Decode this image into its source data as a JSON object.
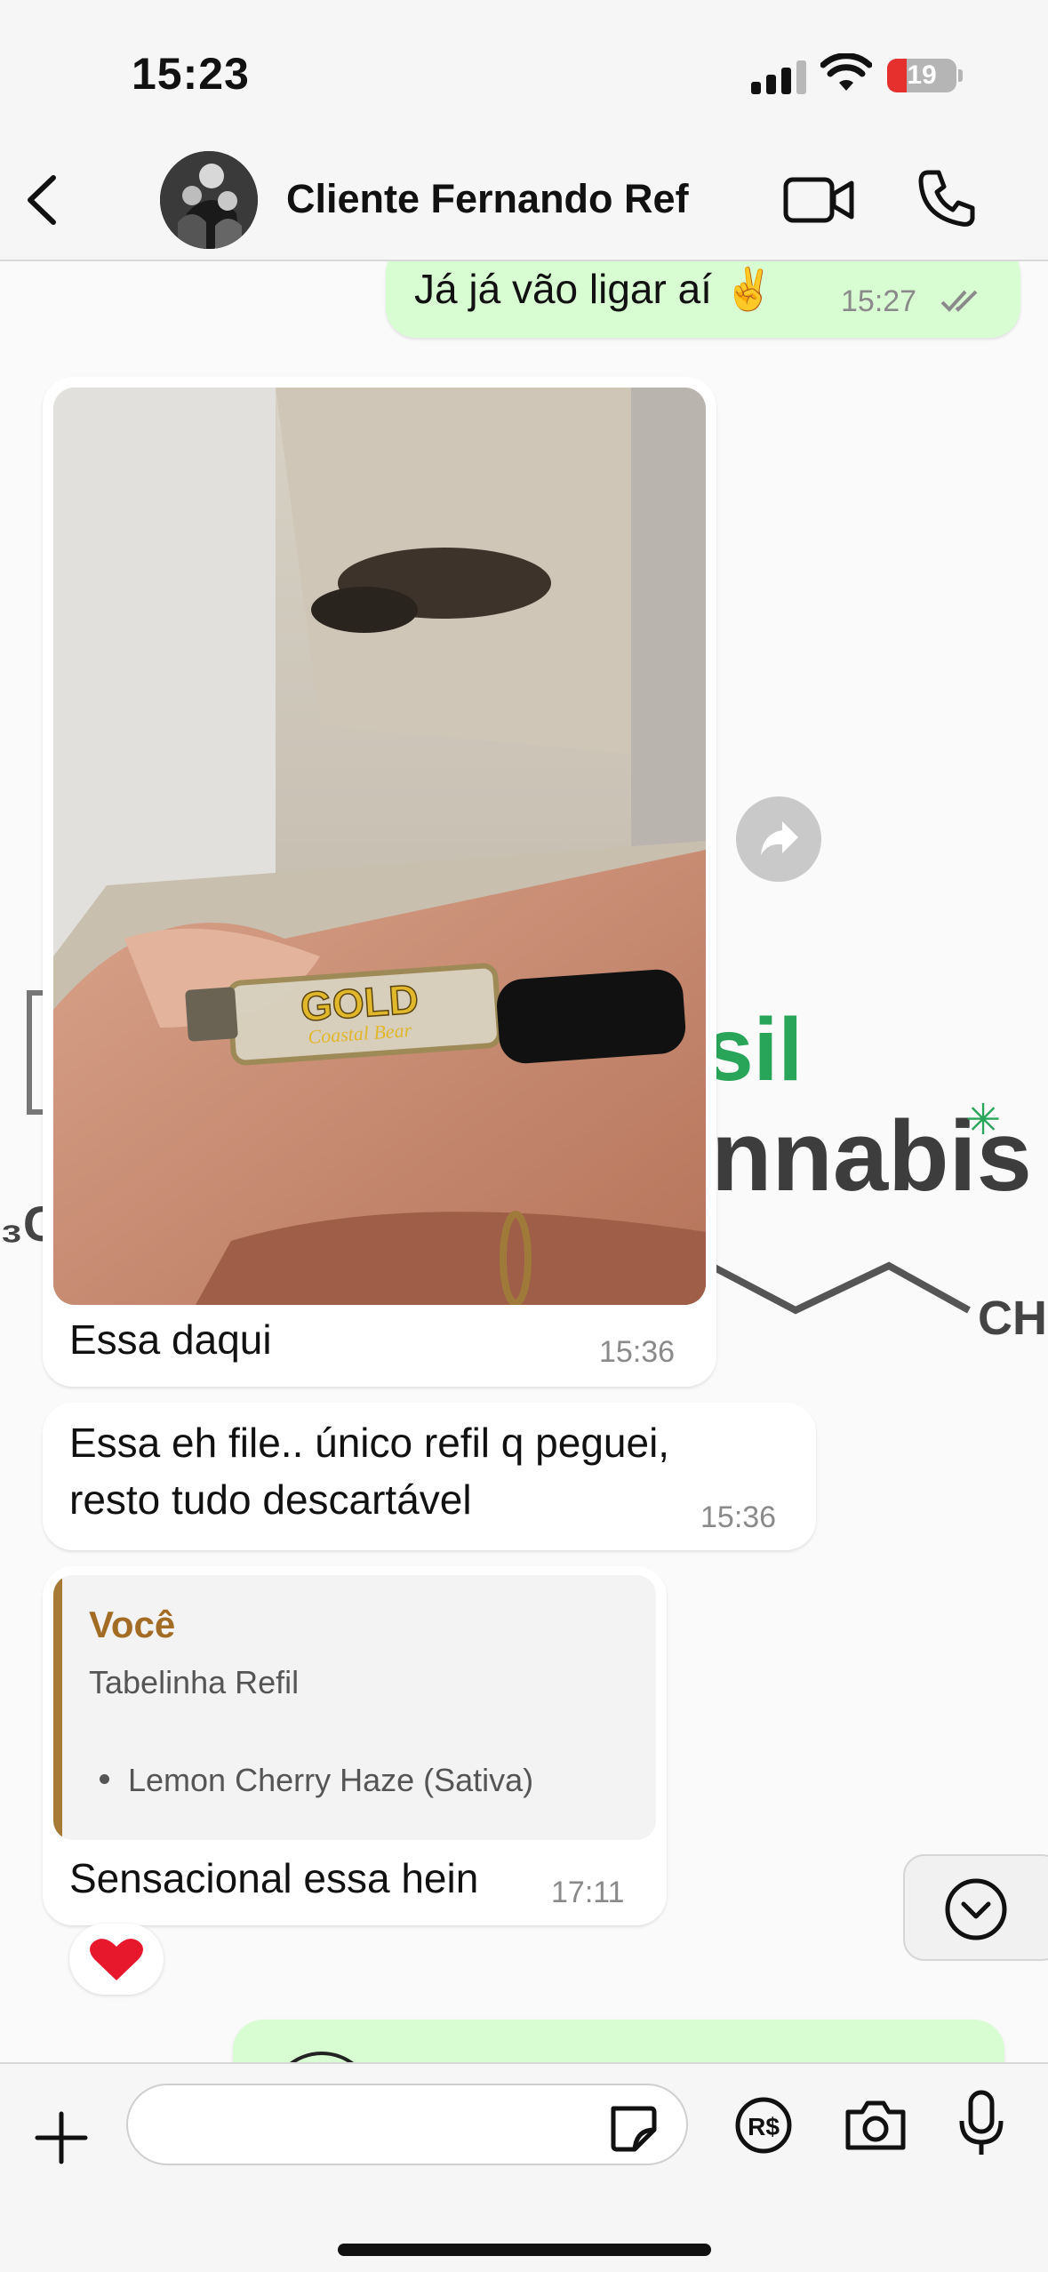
{
  "status_bar": {
    "time": "15:23",
    "battery_level": "19",
    "icons": [
      "cellular-signal-icon",
      "wifi-icon",
      "battery-icon"
    ]
  },
  "header": {
    "contact_name": "Cliente Fernando Ref",
    "icons": [
      "back-chevron-icon",
      "contact-avatar",
      "video-call-icon",
      "phone-call-icon"
    ]
  },
  "wallpaper": {
    "word1": "sil",
    "word2": "nnabis",
    "chem_left": "₃C",
    "chem_right": "CH"
  },
  "messages": [
    {
      "direction": "out",
      "text": "Já já vão ligar aí ✌️",
      "time": "15:27",
      "status": "read"
    },
    {
      "direction": "in",
      "type": "photo",
      "caption": "Essa daqui",
      "time": "15:36",
      "photo_label_1": "GOLD",
      "photo_label_2": "Coastal Bear"
    },
    {
      "direction": "in",
      "lines": [
        "Essa eh file.. único refil q peguei,",
        "resto tudo descartável"
      ],
      "time": "15:36"
    },
    {
      "direction": "in",
      "reply_to": {
        "author": "Você",
        "title": "Tabelinha Refil",
        "item": "Lemon Cherry Haze (Sativa)"
      },
      "text": "Sensacional essa hein",
      "time": "17:11",
      "reaction": "❤️"
    }
  ],
  "colors": {
    "outgoing_bubble": "#d9fdd3",
    "incoming_bubble": "#ffffff",
    "quote_author": "#a36c24"
  },
  "input_bar": {
    "placeholder": "",
    "icons": [
      "plus-icon",
      "sticker-icon",
      "payment-icon",
      "camera-icon",
      "microphone-icon"
    ]
  }
}
